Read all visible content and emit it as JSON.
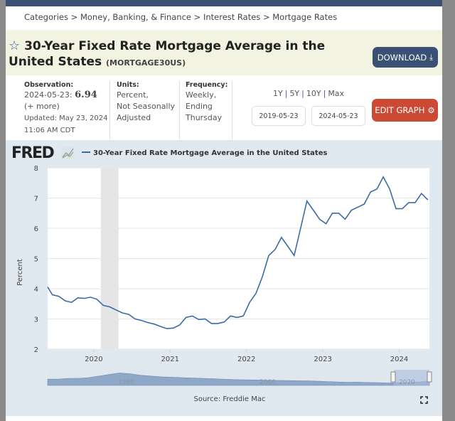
{
  "breadcrumb": [
    "Categories",
    "Money, Banking, & Finance",
    "Interest Rates",
    "Mortgage Rates"
  ],
  "title": "30-Year Fixed Rate Mortgage Average in the United States",
  "series_id": "(MORTGAGE30US)",
  "download_label": "DOWNLOAD",
  "edit_label": "EDIT GRAPH",
  "observation": {
    "label": "Observation:",
    "date": "2024-05-23:",
    "value": "6.94",
    "more": "(+ more)",
    "updated": "Updated: May 23, 2024",
    "time": "11:06 AM CDT"
  },
  "units": {
    "label": "Units:",
    "l1": "Percent,",
    "l2": "Not Seasonally",
    "l3": "Adjusted"
  },
  "frequency": {
    "label": "Frequency:",
    "l1": "Weekly,",
    "l2": "Ending",
    "l3": "Thursday"
  },
  "ranges": [
    "1Y",
    "5Y",
    "10Y",
    "Max"
  ],
  "start_date": "2019-05-23",
  "end_date": "2024-05-23",
  "logo": "FRED",
  "source": "Source: Freddie Mac",
  "navigator_labels": [
    "1980",
    "2000",
    "2020"
  ],
  "colors": {
    "line": "#3a6aa8",
    "panel": "#e1e9f0",
    "download": "#3a5074",
    "edit": "#cc4a35",
    "recession": "#e5e5e5"
  },
  "chart_data": {
    "type": "line",
    "legend": "30-Year Fixed Rate Mortgage Average in the United States",
    "ylabel": "Percent",
    "ylim": [
      2,
      8
    ],
    "yticks": [
      "2",
      "3",
      "4",
      "5",
      "6",
      "7",
      "8"
    ],
    "xticks": [
      "2020",
      "2021",
      "2022",
      "2023",
      "2024"
    ],
    "xlim": [
      "2019-05",
      "2024-05"
    ],
    "recession": [
      "2020-02",
      "2020-04"
    ],
    "x": [
      "2019-05",
      "2019-06",
      "2019-07",
      "2019-08",
      "2019-09",
      "2019-10",
      "2019-11",
      "2019-12",
      "2020-01",
      "2020-02",
      "2020-03",
      "2020-04",
      "2020-05",
      "2020-06",
      "2020-07",
      "2020-08",
      "2020-09",
      "2020-10",
      "2020-11",
      "2020-12",
      "2021-01",
      "2021-02",
      "2021-03",
      "2021-04",
      "2021-05",
      "2021-06",
      "2021-07",
      "2021-08",
      "2021-09",
      "2021-10",
      "2021-11",
      "2021-12",
      "2022-01",
      "2022-02",
      "2022-03",
      "2022-04",
      "2022-05",
      "2022-06",
      "2022-07",
      "2022-08",
      "2022-09",
      "2022-10",
      "2022-11",
      "2022-12",
      "2023-01",
      "2023-02",
      "2023-03",
      "2023-04",
      "2023-05",
      "2023-06",
      "2023-07",
      "2023-08",
      "2023-09",
      "2023-10",
      "2023-11",
      "2023-12",
      "2024-01",
      "2024-02",
      "2024-03",
      "2024-04",
      "2024-05"
    ],
    "values": [
      4.06,
      3.8,
      3.75,
      3.6,
      3.55,
      3.7,
      3.68,
      3.72,
      3.65,
      3.45,
      3.4,
      3.3,
      3.2,
      3.15,
      3.0,
      2.95,
      2.88,
      2.83,
      2.75,
      2.68,
      2.7,
      2.8,
      3.05,
      3.1,
      2.98,
      3.0,
      2.85,
      2.85,
      2.9,
      3.1,
      3.05,
      3.1,
      3.55,
      3.85,
      4.4,
      5.1,
      5.3,
      5.7,
      5.4,
      5.1,
      6.0,
      6.9,
      6.6,
      6.3,
      6.15,
      6.5,
      6.5,
      6.3,
      6.6,
      6.7,
      6.8,
      7.2,
      7.3,
      7.7,
      7.3,
      6.65,
      6.65,
      6.85,
      6.85,
      7.15,
      6.94
    ]
  }
}
